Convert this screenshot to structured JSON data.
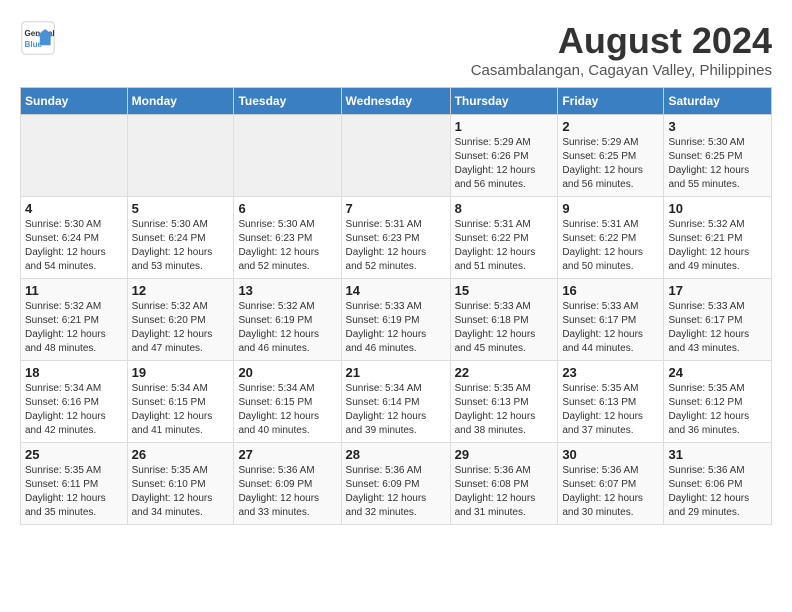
{
  "logo": {
    "line1": "General",
    "line2": "Blue"
  },
  "title": "August 2024",
  "subtitle": "Casambalangan, Cagayan Valley, Philippines",
  "headers": [
    "Sunday",
    "Monday",
    "Tuesday",
    "Wednesday",
    "Thursday",
    "Friday",
    "Saturday"
  ],
  "weeks": [
    [
      {
        "day": "",
        "info": ""
      },
      {
        "day": "",
        "info": ""
      },
      {
        "day": "",
        "info": ""
      },
      {
        "day": "",
        "info": ""
      },
      {
        "day": "1",
        "info": "Sunrise: 5:29 AM\nSunset: 6:26 PM\nDaylight: 12 hours\nand 56 minutes."
      },
      {
        "day": "2",
        "info": "Sunrise: 5:29 AM\nSunset: 6:25 PM\nDaylight: 12 hours\nand 56 minutes."
      },
      {
        "day": "3",
        "info": "Sunrise: 5:30 AM\nSunset: 6:25 PM\nDaylight: 12 hours\nand 55 minutes."
      }
    ],
    [
      {
        "day": "4",
        "info": "Sunrise: 5:30 AM\nSunset: 6:24 PM\nDaylight: 12 hours\nand 54 minutes."
      },
      {
        "day": "5",
        "info": "Sunrise: 5:30 AM\nSunset: 6:24 PM\nDaylight: 12 hours\nand 53 minutes."
      },
      {
        "day": "6",
        "info": "Sunrise: 5:30 AM\nSunset: 6:23 PM\nDaylight: 12 hours\nand 52 minutes."
      },
      {
        "day": "7",
        "info": "Sunrise: 5:31 AM\nSunset: 6:23 PM\nDaylight: 12 hours\nand 52 minutes."
      },
      {
        "day": "8",
        "info": "Sunrise: 5:31 AM\nSunset: 6:22 PM\nDaylight: 12 hours\nand 51 minutes."
      },
      {
        "day": "9",
        "info": "Sunrise: 5:31 AM\nSunset: 6:22 PM\nDaylight: 12 hours\nand 50 minutes."
      },
      {
        "day": "10",
        "info": "Sunrise: 5:32 AM\nSunset: 6:21 PM\nDaylight: 12 hours\nand 49 minutes."
      }
    ],
    [
      {
        "day": "11",
        "info": "Sunrise: 5:32 AM\nSunset: 6:21 PM\nDaylight: 12 hours\nand 48 minutes."
      },
      {
        "day": "12",
        "info": "Sunrise: 5:32 AM\nSunset: 6:20 PM\nDaylight: 12 hours\nand 47 minutes."
      },
      {
        "day": "13",
        "info": "Sunrise: 5:32 AM\nSunset: 6:19 PM\nDaylight: 12 hours\nand 46 minutes."
      },
      {
        "day": "14",
        "info": "Sunrise: 5:33 AM\nSunset: 6:19 PM\nDaylight: 12 hours\nand 46 minutes."
      },
      {
        "day": "15",
        "info": "Sunrise: 5:33 AM\nSunset: 6:18 PM\nDaylight: 12 hours\nand 45 minutes."
      },
      {
        "day": "16",
        "info": "Sunrise: 5:33 AM\nSunset: 6:17 PM\nDaylight: 12 hours\nand 44 minutes."
      },
      {
        "day": "17",
        "info": "Sunrise: 5:33 AM\nSunset: 6:17 PM\nDaylight: 12 hours\nand 43 minutes."
      }
    ],
    [
      {
        "day": "18",
        "info": "Sunrise: 5:34 AM\nSunset: 6:16 PM\nDaylight: 12 hours\nand 42 minutes."
      },
      {
        "day": "19",
        "info": "Sunrise: 5:34 AM\nSunset: 6:15 PM\nDaylight: 12 hours\nand 41 minutes."
      },
      {
        "day": "20",
        "info": "Sunrise: 5:34 AM\nSunset: 6:15 PM\nDaylight: 12 hours\nand 40 minutes."
      },
      {
        "day": "21",
        "info": "Sunrise: 5:34 AM\nSunset: 6:14 PM\nDaylight: 12 hours\nand 39 minutes."
      },
      {
        "day": "22",
        "info": "Sunrise: 5:35 AM\nSunset: 6:13 PM\nDaylight: 12 hours\nand 38 minutes."
      },
      {
        "day": "23",
        "info": "Sunrise: 5:35 AM\nSunset: 6:13 PM\nDaylight: 12 hours\nand 37 minutes."
      },
      {
        "day": "24",
        "info": "Sunrise: 5:35 AM\nSunset: 6:12 PM\nDaylight: 12 hours\nand 36 minutes."
      }
    ],
    [
      {
        "day": "25",
        "info": "Sunrise: 5:35 AM\nSunset: 6:11 PM\nDaylight: 12 hours\nand 35 minutes."
      },
      {
        "day": "26",
        "info": "Sunrise: 5:35 AM\nSunset: 6:10 PM\nDaylight: 12 hours\nand 34 minutes."
      },
      {
        "day": "27",
        "info": "Sunrise: 5:36 AM\nSunset: 6:09 PM\nDaylight: 12 hours\nand 33 minutes."
      },
      {
        "day": "28",
        "info": "Sunrise: 5:36 AM\nSunset: 6:09 PM\nDaylight: 12 hours\nand 32 minutes."
      },
      {
        "day": "29",
        "info": "Sunrise: 5:36 AM\nSunset: 6:08 PM\nDaylight: 12 hours\nand 31 minutes."
      },
      {
        "day": "30",
        "info": "Sunrise: 5:36 AM\nSunset: 6:07 PM\nDaylight: 12 hours\nand 30 minutes."
      },
      {
        "day": "31",
        "info": "Sunrise: 5:36 AM\nSunset: 6:06 PM\nDaylight: 12 hours\nand 29 minutes."
      }
    ]
  ]
}
